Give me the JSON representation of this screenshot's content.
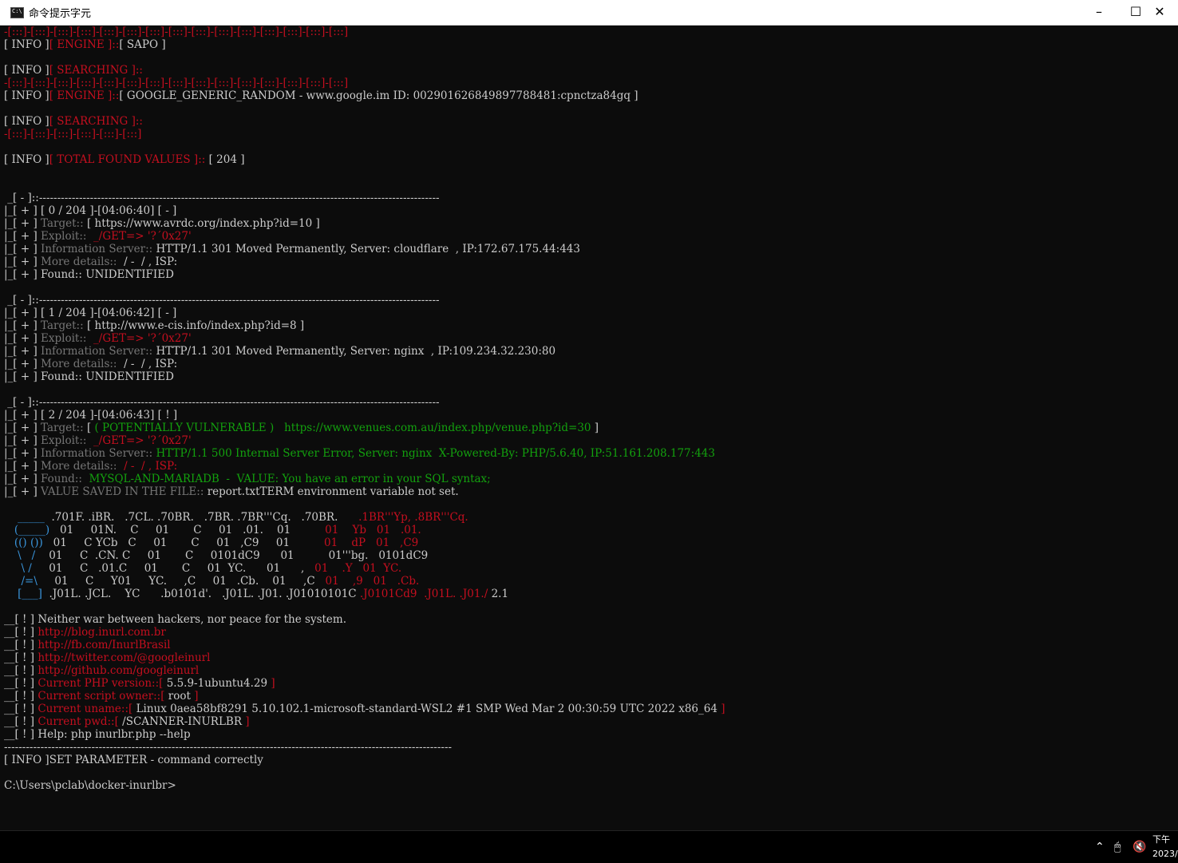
{
  "window": {
    "title": "命令提示字元",
    "min_icon": "minimize-icon",
    "max_icon": "maximize-icon",
    "close_icon": "close-icon"
  },
  "colors": {
    "bg": "#0c0c0c",
    "text": "#cccccc",
    "red": "#c50f1f",
    "green": "#13a10e",
    "blue": "#3a96dd"
  },
  "console": {
    "lines": [
      [
        [
          "r",
          "-[:::]-[:::]-[:::]-[:::]-[:::]-[:::]-[:::]-[:::]-[:::]-[:::]-[:::]-[:::]-[:::]-[:::]-[:::]"
        ]
      ],
      [
        [
          "w",
          "[ INFO ]"
        ],
        [
          "r",
          "[ ENGINE ]::"
        ],
        [
          "w",
          "[ SAPO ]"
        ]
      ],
      [
        [
          "w",
          ""
        ]
      ],
      [
        [
          "w",
          "[ INFO ]"
        ],
        [
          "r",
          "[ SEARCHING ]::"
        ]
      ],
      [
        [
          "r",
          "-[:::]-[:::]-[:::]-[:::]-[:::]-[:::]-[:::]-[:::]-[:::]-[:::]-[:::]-[:::]-[:::]-[:::]-[:::]"
        ]
      ],
      [
        [
          "w",
          "[ INFO ]"
        ],
        [
          "r",
          "[ ENGINE ]::"
        ],
        [
          "w",
          "[ GOOGLE_GENERIC_RANDOM - www.google.im ID: 002901626849897788481:cpnctza84gq ]"
        ]
      ],
      [
        [
          "w",
          ""
        ]
      ],
      [
        [
          "w",
          "[ INFO ]"
        ],
        [
          "r",
          "[ SEARCHING ]::"
        ]
      ],
      [
        [
          "r",
          "-[:::]-[:::]-[:::]-[:::]-[:::]-[:::]"
        ]
      ],
      [
        [
          "w",
          ""
        ]
      ],
      [
        [
          "w",
          "[ INFO ]"
        ],
        [
          "r",
          "[ TOTAL FOUND VALUES ]::"
        ],
        [
          "w",
          " [ 204 ]"
        ]
      ],
      [
        [
          "w",
          ""
        ]
      ],
      [
        [
          "w",
          ""
        ]
      ],
      [
        [
          "w",
          " _[ - ]::--------------------------------------------------------------------------------------------------------------"
        ]
      ],
      [
        [
          "w",
          "|_[ + ] [ 0 / 204 ]-[04:06:40] [ - ]"
        ]
      ],
      [
        [
          "w",
          "|_[ + ] "
        ],
        [
          "dim",
          "Target:: "
        ],
        [
          "w",
          "[ https://www.avrdc.org/index.php?id=10 ]"
        ]
      ],
      [
        [
          "w",
          "|_[ + ] "
        ],
        [
          "dim",
          "Exploit::  "
        ],
        [
          "r",
          "_/GET=> '?´0x27'"
        ]
      ],
      [
        [
          "w",
          "|_[ + ] "
        ],
        [
          "dim",
          "Information Server:: "
        ],
        [
          "w",
          "HTTP/1.1 301 Moved Permanently, Server: cloudflare  , IP:172.67.175.44:443"
        ]
      ],
      [
        [
          "w",
          "|_[ + ] "
        ],
        [
          "dim",
          "More details:: "
        ],
        [
          "w",
          " / -  / , ISP:"
        ]
      ],
      [
        [
          "w",
          "|_[ + ] Found:: UNIDENTIFIED"
        ]
      ],
      [
        [
          "w",
          ""
        ]
      ],
      [
        [
          "w",
          " _[ - ]::--------------------------------------------------------------------------------------------------------------"
        ]
      ],
      [
        [
          "w",
          "|_[ + ] [ 1 / 204 ]-[04:06:42] [ - ]"
        ]
      ],
      [
        [
          "w",
          "|_[ + ] "
        ],
        [
          "dim",
          "Target:: "
        ],
        [
          "w",
          "[ http://www.e-cis.info/index.php?id=8 ]"
        ]
      ],
      [
        [
          "w",
          "|_[ + ] "
        ],
        [
          "dim",
          "Exploit::  "
        ],
        [
          "r",
          "_/GET=> '?´0x27'"
        ]
      ],
      [
        [
          "w",
          "|_[ + ] "
        ],
        [
          "dim",
          "Information Server:: "
        ],
        [
          "w",
          "HTTP/1.1 301 Moved Permanently, Server: nginx  , IP:109.234.32.230:80"
        ]
      ],
      [
        [
          "w",
          "|_[ + ] "
        ],
        [
          "dim",
          "More details:: "
        ],
        [
          "w",
          " / -  / , ISP:"
        ]
      ],
      [
        [
          "w",
          "|_[ + ] Found:: UNIDENTIFIED"
        ]
      ],
      [
        [
          "w",
          ""
        ]
      ],
      [
        [
          "w",
          " _[ - ]::--------------------------------------------------------------------------------------------------------------"
        ]
      ],
      [
        [
          "w",
          "|_[ + ] [ 2 / 204 ]-[04:06:43] [ ! ]"
        ]
      ],
      [
        [
          "w",
          "|_[ + ] "
        ],
        [
          "dim",
          "Target:: "
        ],
        [
          "w",
          "[ "
        ],
        [
          "g",
          "( POTENTIALLY VULNERABLE )   https://www.venues.com.au/index.php/venue.php?id=30"
        ],
        [
          "w",
          " ]"
        ]
      ],
      [
        [
          "w",
          "|_[ + ] "
        ],
        [
          "dim",
          "Exploit::  "
        ],
        [
          "r",
          "_/GET=> '?´0x27'"
        ]
      ],
      [
        [
          "w",
          "|_[ + ] "
        ],
        [
          "dim",
          "Information Server:: "
        ],
        [
          "g",
          "HTTP/1.1 500 Internal Server Error, Server: nginx  X-Powered-By: PHP/5.6.40, IP:51.161.208.177:443"
        ]
      ],
      [
        [
          "w",
          "|_[ + ] "
        ],
        [
          "dim",
          "More details:: "
        ],
        [
          "r",
          " / -  / , ISP:"
        ]
      ],
      [
        [
          "w",
          "|_[ + ] "
        ],
        [
          "dim",
          "Found:: "
        ],
        [
          "g",
          " MYSQL-AND-MARIADB  -  VALUE: You have an error in your SQL syntax;"
        ]
      ],
      [
        [
          "w",
          "|_[ + ] "
        ],
        [
          "dim",
          "VALUE SAVED IN THE FILE:: "
        ],
        [
          "w",
          "report.txtTERM environment variable not set."
        ]
      ],
      [
        [
          "w",
          ""
        ]
      ],
      [
        [
          "b",
          "    _____  "
        ],
        [
          "w",
          ".701F. .iBR.   .7CL. .70BR.   .7BR. .7BR'''Cq.   .70BR.      "
        ],
        [
          "r",
          ".1BR'''Yp, .8BR'''Cq."
        ]
      ],
      [
        [
          "b",
          "   (_____)  "
        ],
        [
          "w",
          " 01     01N.    C     01       C     01   .01.    01          "
        ],
        [
          "r",
          "01    Yb   01   .01."
        ]
      ],
      [
        [
          "b",
          "   (() ())  "
        ],
        [
          "w",
          " 01     C YCb   C     01       C     01   ,C9     01          "
        ],
        [
          "r",
          "01    dP   01   ,C9"
        ]
      ],
      [
        [
          "b",
          "    \\   /   "
        ],
        [
          "w",
          " 01     C  .CN. C     01       C     0101dC9      01          "
        ],
        [
          "w",
          "01'''bg.   0101dC9"
        ]
      ],
      [
        [
          "b",
          "     \\ /    "
        ],
        [
          "w",
          " 01     C   .01.C     01       C     01  YC.      01      ,   "
        ],
        [
          "r",
          "01    .Y   01  YC."
        ]
      ],
      [
        [
          "b",
          "     /=\\    "
        ],
        [
          "w",
          " 01     C     Y01     YC.     ,C     01   .Cb.    01     ,C   "
        ],
        [
          "r",
          "01    ,9   01   .Cb."
        ]
      ],
      [
        [
          "b",
          "    [___]  "
        ],
        [
          "w",
          ".J01L. .JCL.    YC      .b0101d'.   .J01L. .J01. .J01010101C "
        ],
        [
          "r",
          ".J0101Cd9  .J01L. .J01./ "
        ],
        [
          "w",
          "2.1"
        ]
      ],
      [
        [
          "w",
          ""
        ]
      ],
      [
        [
          "w",
          "__[ ! ] Neither war between hackers, nor peace for the system."
        ]
      ],
      [
        [
          "w",
          "__[ ! ] "
        ],
        [
          "r",
          "http://blog.inurl.com.br"
        ]
      ],
      [
        [
          "w",
          "__[ ! ] "
        ],
        [
          "r",
          "http://fb.com/InurlBrasil"
        ]
      ],
      [
        [
          "w",
          "__[ ! ] "
        ],
        [
          "r",
          "http://twitter.com/@googleinurl"
        ]
      ],
      [
        [
          "w",
          "__[ ! ] "
        ],
        [
          "r",
          "http://github.com/googleinurl"
        ]
      ],
      [
        [
          "w",
          "__[ ! ] "
        ],
        [
          "r",
          "Current PHP version::[ "
        ],
        [
          "w",
          "5.5.9-1ubuntu4.29"
        ],
        [
          "r",
          " ]"
        ]
      ],
      [
        [
          "w",
          "__[ ! ] "
        ],
        [
          "r",
          "Current script owner::[ "
        ],
        [
          "w",
          "root"
        ],
        [
          "r",
          " ]"
        ]
      ],
      [
        [
          "w",
          "__[ ! ] "
        ],
        [
          "r",
          "Current uname::[ "
        ],
        [
          "w",
          "Linux 0aea58bf8291 5.10.102.1-microsoft-standard-WSL2 #1 SMP Wed Mar 2 00:30:59 UTC 2022 x86_64"
        ],
        [
          "r",
          " ]"
        ]
      ],
      [
        [
          "w",
          "__[ ! ] "
        ],
        [
          "r",
          "Current pwd::[ "
        ],
        [
          "w",
          "/SCANNER-INURLBR"
        ],
        [
          "r",
          " ]"
        ]
      ],
      [
        [
          "w",
          "__[ ! ] Help: php inurlbr.php --help"
        ]
      ],
      [
        [
          "w",
          "---------------------------------------------------------------------------------------------------------------------------"
        ]
      ],
      [
        [
          "w",
          "[ INFO ]SET PARAMETER - command correctly"
        ]
      ],
      [
        [
          "w",
          ""
        ]
      ],
      [
        [
          "w",
          "C:\\Users\\pclab\\docker-inurlbr>"
        ]
      ]
    ]
  },
  "taskbar": {
    "tray_up_icon": "chevron-up-icon",
    "network_icon": "network-icon",
    "volume_icon": "volume-muted-icon",
    "clock_line1": "下午",
    "clock_line2": "2023/"
  }
}
